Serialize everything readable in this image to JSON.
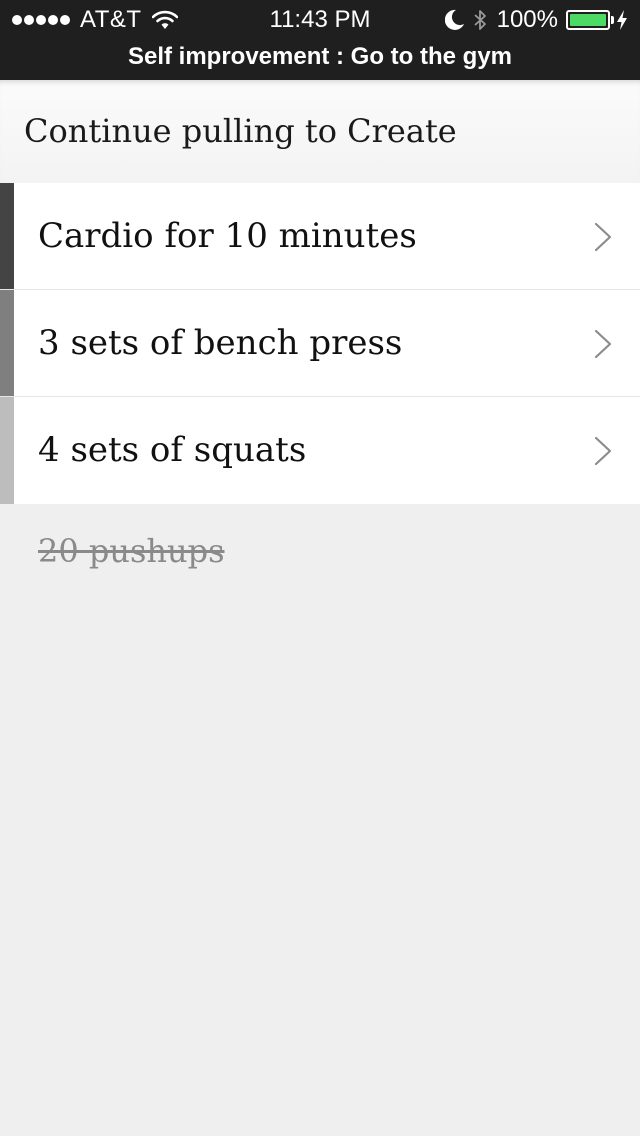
{
  "status_bar": {
    "signal_icon": "signal-dots-icon",
    "signal_bars": 5,
    "carrier": "AT&T",
    "wifi_icon": "wifi-icon",
    "time": "11:43 PM",
    "dnd_icon": "moon-icon",
    "bluetooth_icon": "bluetooth-icon",
    "battery_percent": "100%",
    "battery_level": 1.0,
    "battery_color": "#4cd964",
    "charging_icon": "charging-bolt-icon"
  },
  "nav": {
    "title": "Self improvement :  Go to the gym"
  },
  "pull_banner": {
    "text": "Continue pulling to Create"
  },
  "tasks": [
    {
      "label": "Cardio for 10 minutes",
      "stripe_color": "#444444",
      "chevron_icon": "chevron-right-icon"
    },
    {
      "label": "3 sets of bench press",
      "stripe_color": "#7f7f7f",
      "chevron_icon": "chevron-right-icon"
    },
    {
      "label": "4 sets of squats",
      "stripe_color": "#bdbdbd",
      "chevron_icon": "chevron-right-icon"
    }
  ],
  "completed": [
    {
      "label": "20 pushups"
    }
  ],
  "colors": {
    "bars_background": "#1f1f1f",
    "list_background": "#efefef",
    "row_background": "#ffffff",
    "completed_text": "#8a8a8a"
  }
}
